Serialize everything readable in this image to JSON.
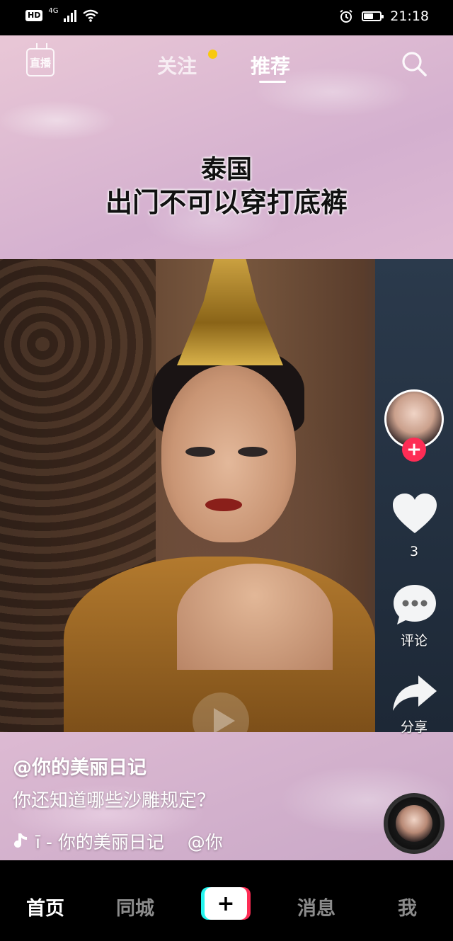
{
  "status_bar": {
    "hd": "HD",
    "network": "4G",
    "time": "21:18",
    "icons": [
      "wifi-icon",
      "alarm-icon",
      "battery-icon"
    ],
    "battery_level": 0.6
  },
  "top_nav": {
    "live_label": "直播",
    "follow_tab": "关注",
    "recommend_tab": "推荐",
    "active_tab": "推荐",
    "has_follow_dot": true,
    "dot_color": "#f8c90e",
    "search_icon": "search-icon"
  },
  "video": {
    "caption_line1": "泰国",
    "caption_line2": "出门不可以穿打底裤"
  },
  "actions": {
    "like_count": "3",
    "comment_label": "评论",
    "share_label": "分享",
    "follow_plus": "+",
    "accent_color": "#fe2c55"
  },
  "info": {
    "author": "@你的美丽日记",
    "description": "你还知道哪些沙雕规定？",
    "music_text": "ī - 你的美丽日记　 @你"
  },
  "tab_bar": {
    "home": "首页",
    "nearby": "同城",
    "create": "+",
    "messages": "消息",
    "me": "我",
    "active": "首页"
  }
}
